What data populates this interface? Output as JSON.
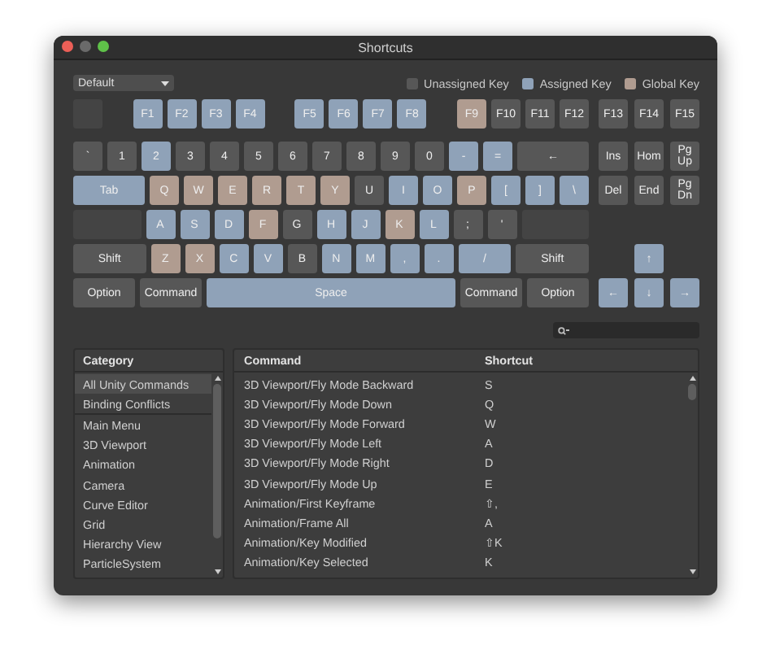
{
  "window": {
    "title": "Shortcuts"
  },
  "profile": {
    "value": "Default"
  },
  "legend": [
    {
      "label": "Unassigned Key",
      "color": "#575757"
    },
    {
      "label": "Assigned Key",
      "color": "#8fa2b8"
    },
    {
      "label": "Global Key",
      "color": "#b09c90"
    }
  ],
  "function_row": {
    "groups": [
      [
        {
          "color": "#444444"
        }
      ],
      [
        {
          "label": "F1",
          "color": "#8fa2b8"
        },
        {
          "label": "F2",
          "color": "#8fa2b8"
        },
        {
          "label": "F3",
          "color": "#8fa2b8"
        },
        {
          "label": "F4",
          "color": "#8fa2b8"
        }
      ],
      [
        {
          "label": "F5",
          "color": "#8fa2b8"
        },
        {
          "label": "F6",
          "color": "#8fa2b8"
        },
        {
          "label": "F7",
          "color": "#8fa2b8"
        },
        {
          "label": "F8",
          "color": "#8fa2b8"
        }
      ],
      [
        {
          "label": "F9",
          "color": "#b09c90"
        },
        {
          "label": "F10",
          "color": "#575757"
        },
        {
          "label": "F11",
          "color": "#575757"
        },
        {
          "label": "F12",
          "color": "#575757"
        }
      ]
    ],
    "side": [
      {
        "label": "F13",
        "color": "#575757"
      },
      {
        "label": "F14",
        "color": "#575757"
      },
      {
        "label": "F15",
        "color": "#575757"
      }
    ]
  },
  "rows": [
    {
      "main": [
        {
          "label": "`",
          "color": "#575757"
        },
        {
          "label": "1",
          "color": "#575757"
        },
        {
          "label": "2",
          "color": "#8fa2b8"
        },
        {
          "label": "3",
          "color": "#575757"
        },
        {
          "label": "4",
          "color": "#575757"
        },
        {
          "label": "5",
          "color": "#575757"
        },
        {
          "label": "6",
          "color": "#575757"
        },
        {
          "label": "7",
          "color": "#575757"
        },
        {
          "label": "8",
          "color": "#575757"
        },
        {
          "label": "9",
          "color": "#575757"
        },
        {
          "label": "0",
          "color": "#575757"
        },
        {
          "label": "-",
          "color": "#8fa2b8"
        },
        {
          "label": "=",
          "color": "#8fa2b8"
        },
        {
          "label": "←",
          "color": "#575757",
          "kind": "wide"
        }
      ],
      "side": [
        {
          "label": "Ins",
          "color": "#575757"
        },
        {
          "label": "Hom",
          "color": "#575757"
        },
        {
          "label": "Pg Up",
          "color": "#575757"
        }
      ]
    },
    {
      "main": [
        {
          "label": "Tab",
          "color": "#8fa2b8",
          "kind": "wide"
        },
        {
          "label": "Q",
          "color": "#b09c90"
        },
        {
          "label": "W",
          "color": "#b09c90"
        },
        {
          "label": "E",
          "color": "#b09c90"
        },
        {
          "label": "R",
          "color": "#b09c90"
        },
        {
          "label": "T",
          "color": "#b09c90"
        },
        {
          "label": "Y",
          "color": "#b09c90"
        },
        {
          "label": "U",
          "color": "#575757"
        },
        {
          "label": "I",
          "color": "#8fa2b8"
        },
        {
          "label": "O",
          "color": "#8fa2b8"
        },
        {
          "label": "P",
          "color": "#b09c90"
        },
        {
          "label": "[",
          "color": "#8fa2b8"
        },
        {
          "label": "]",
          "color": "#8fa2b8"
        },
        {
          "label": "\\",
          "color": "#8fa2b8"
        }
      ],
      "side": [
        {
          "label": "Del",
          "color": "#575757"
        },
        {
          "label": "End",
          "color": "#575757"
        },
        {
          "label": "Pg Dn",
          "color": "#575757"
        }
      ]
    },
    {
      "main": [
        {
          "color": "#444444",
          "kind": "wide"
        },
        {
          "label": "A",
          "color": "#8fa2b8"
        },
        {
          "label": "S",
          "color": "#8fa2b8"
        },
        {
          "label": "D",
          "color": "#8fa2b8"
        },
        {
          "label": "F",
          "color": "#b09c90"
        },
        {
          "label": "G",
          "color": "#575757"
        },
        {
          "label": "H",
          "color": "#8fa2b8"
        },
        {
          "label": "J",
          "color": "#8fa2b8"
        },
        {
          "label": "K",
          "color": "#b09c90"
        },
        {
          "label": "L",
          "color": "#8fa2b8"
        },
        {
          "label": ";",
          "color": "#575757"
        },
        {
          "label": "'",
          "color": "#575757"
        },
        {
          "color": "#444444",
          "kind": "wide"
        }
      ]
    },
    {
      "main": [
        {
          "label": "Shift",
          "color": "#575757",
          "kind": "wide"
        },
        {
          "label": "Z",
          "color": "#b09c90"
        },
        {
          "label": "X",
          "color": "#b09c90"
        },
        {
          "label": "C",
          "color": "#8fa2b8"
        },
        {
          "label": "V",
          "color": "#8fa2b8"
        },
        {
          "label": "B",
          "color": "#575757"
        },
        {
          "label": "N",
          "color": "#8fa2b8"
        },
        {
          "label": "M",
          "color": "#8fa2b8"
        },
        {
          "label": ",",
          "color": "#8fa2b8"
        },
        {
          "label": ".",
          "color": "#8fa2b8"
        },
        {
          "label": "/",
          "color": "#8fa2b8",
          "kind": "wide"
        },
        {
          "label": "Shift",
          "color": "#575757",
          "kind": "wide"
        }
      ],
      "side": [
        {
          "label": "↑",
          "color": "#8fa2b8"
        }
      ]
    },
    {
      "main": [
        {
          "label": "Option",
          "color": "#575757",
          "kind": "modifier"
        },
        {
          "label": "Command",
          "color": "#575757",
          "kind": "modifier"
        },
        {
          "label": "Space",
          "color": "#8fa2b8",
          "kind": "wide"
        },
        {
          "label": "Command",
          "color": "#575757",
          "kind": "modifier"
        },
        {
          "label": "Option",
          "color": "#575757",
          "kind": "modifier"
        }
      ],
      "side": [
        {
          "label": "←",
          "color": "#8fa2b8"
        },
        {
          "label": "↓",
          "color": "#8fa2b8"
        },
        {
          "label": "→",
          "color": "#8fa2b8"
        }
      ]
    }
  ],
  "categories": {
    "heading": "Category",
    "items": [
      {
        "label": "All Unity Commands",
        "selected": true
      },
      {
        "label": "Binding Conflicts",
        "selected": false
      },
      {
        "label": "Main Menu",
        "selected": false
      },
      {
        "label": "3D Viewport",
        "selected": false
      },
      {
        "label": "Animation",
        "selected": false
      },
      {
        "label": "Camera",
        "selected": false
      },
      {
        "label": "Curve Editor",
        "selected": false
      },
      {
        "label": "Grid",
        "selected": false
      },
      {
        "label": "Hierarchy View",
        "selected": false
      },
      {
        "label": "ParticleSystem",
        "selected": false
      }
    ]
  },
  "commands": {
    "columns": [
      "Command",
      "Shortcut"
    ],
    "rows": [
      [
        "3D Viewport/Fly Mode Backward",
        "S"
      ],
      [
        "3D Viewport/Fly Mode Down",
        "Q"
      ],
      [
        "3D Viewport/Fly Mode Forward",
        "W"
      ],
      [
        "3D Viewport/Fly Mode Left",
        "A"
      ],
      [
        "3D Viewport/Fly Mode Right",
        "D"
      ],
      [
        "3D Viewport/Fly Mode Up",
        "E"
      ],
      [
        "Animation/First Keyframe",
        "⇧,"
      ],
      [
        "Animation/Frame All",
        "A"
      ],
      [
        "Animation/Key Modified",
        "⇧K"
      ],
      [
        "Animation/Key Selected",
        "K"
      ]
    ]
  }
}
